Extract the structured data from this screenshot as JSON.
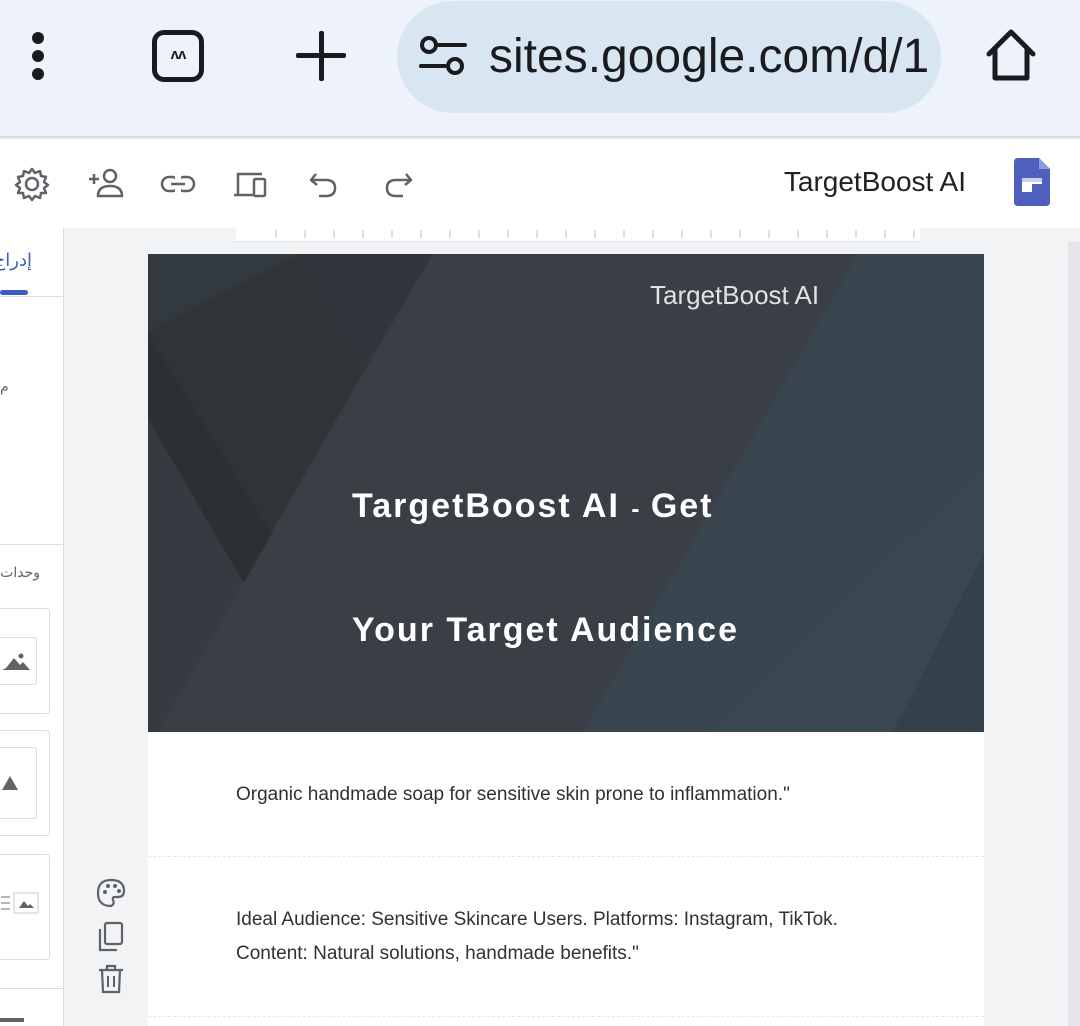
{
  "browser": {
    "url": "sites.google.com/d/1",
    "tab_count_label": "ᴧᴧ",
    "icons": [
      "more-vert-icon",
      "tab-switcher-icon",
      "new-tab-icon",
      "site-info-icon",
      "home-icon"
    ]
  },
  "editor_toolbar": {
    "site_name": "TargetBoost AI",
    "icons": [
      "settings-icon",
      "share-icon",
      "link-icon",
      "preview-icon",
      "undo-icon",
      "redo-icon",
      "google-sites-logo"
    ]
  },
  "left_panel": {
    "insert_tab_label": "إدراج",
    "mini_text": "م",
    "layouts_label": "وحدات"
  },
  "page": {
    "hero_logo_text": "TargetBoost AI",
    "hero_title_line1_a": "TargetBoost AI",
    "hero_title_sep": "-",
    "hero_title_line1_b": "Get",
    "hero_title_line2": "Your Target Audience",
    "section1_text": "Organic handmade soap for sensitive skin prone to inflammation.\"",
    "section2_line1": "Ideal Audience: Sensitive Skincare Users. Platforms: Instagram, TikTok.",
    "section2_line2": "Content: Natural solutions, handmade benefits.\""
  },
  "colors": {
    "accent_blue": "#3c5dbd",
    "hero_bg": "#363d43",
    "omnibox_bg": "#d7e6f0"
  }
}
